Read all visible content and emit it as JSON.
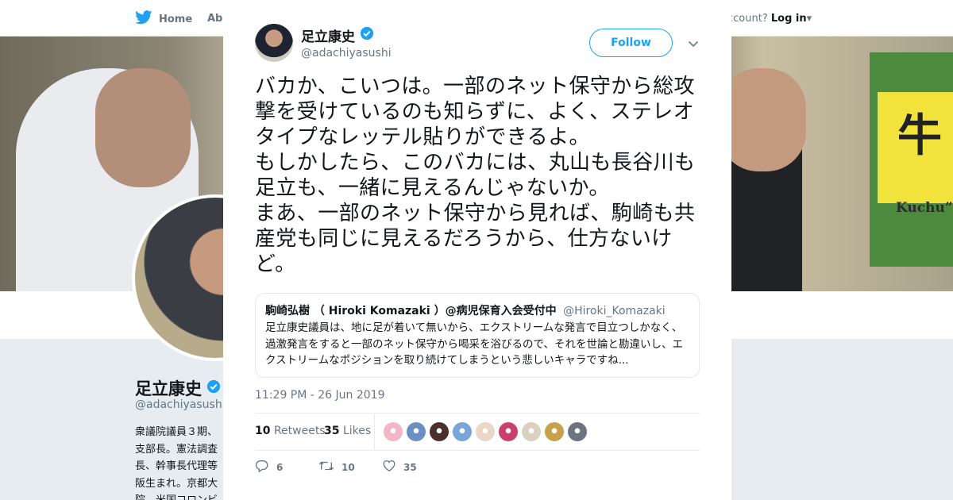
{
  "nav": {
    "home_label": "Home",
    "about_label": "Abo",
    "account_prefix": "ccount?",
    "login_label": "Log in"
  },
  "banner": {
    "kuchu_text": "Kuchu”",
    "sign_text": "牛"
  },
  "profile": {
    "name": "足立康史",
    "handle": "@adachiyasushi",
    "bio_lines": [
      "衆議院議員３期、",
      "支部長。憲法調査",
      "長、幹事長代理等",
      "阪生まれ。京都大",
      "院、米国コロンビ"
    ]
  },
  "tweet": {
    "author_name": "足立康史",
    "author_handle": "@adachiyasushi",
    "follow_label": "Follow",
    "text": "バカか、こいつは。一部のネット保守から総攻撃を受けているのも知らずに、よく、ステレオタイプなレッテル貼りができるよ。\nもしかしたら、このバカには、丸山も長谷川も足立も、一緒に見えるんじゃないか。\nまあ、一部のネット保守から見れば、駒崎も共産党も同じに見えるだろうから、仕方ないけど。",
    "quoted": {
      "name": "駒崎弘樹 （ Hiroki Komazaki ）@病児保育入会受付中",
      "handle": "@Hiroki_Komazaki",
      "text": "足立康史議員は、地に足が着いて無いから、エクストリームな発言で目立つしかなく、過激発言をすると一部のネット保守から喝采を浴びるので、それを世論と勘違いし、エクストリームなポジションを取り続けてしまうという悲しいキャラですね..."
    },
    "timestamp": "11:29 PM - 26 Jun 2019",
    "retweets_count": "10",
    "retweets_label": "Retweets",
    "likes_count": "35",
    "likes_label": "Likes",
    "reply_count": "6",
    "retweet_action_count": "10",
    "like_action_count": "35"
  },
  "liker_colors": [
    "#f3b6c8",
    "#6a8fc4",
    "#4a2f2a",
    "#7aa5d8",
    "#e9d8c8",
    "#c9406a",
    "#d9d2c0",
    "#c8a24a",
    "#6d7380"
  ],
  "colors": {
    "accent": "#1da1f2",
    "text_primary": "#14171a",
    "text_secondary": "#657786",
    "border": "#e6ecf0"
  },
  "icons": {
    "bird": "twitter-bird-icon",
    "verified": "verified-badge-icon",
    "close": "close-icon",
    "caret": "chevron-down-icon",
    "reply": "reply-icon",
    "retweet": "retweet-icon",
    "like": "heart-icon"
  }
}
